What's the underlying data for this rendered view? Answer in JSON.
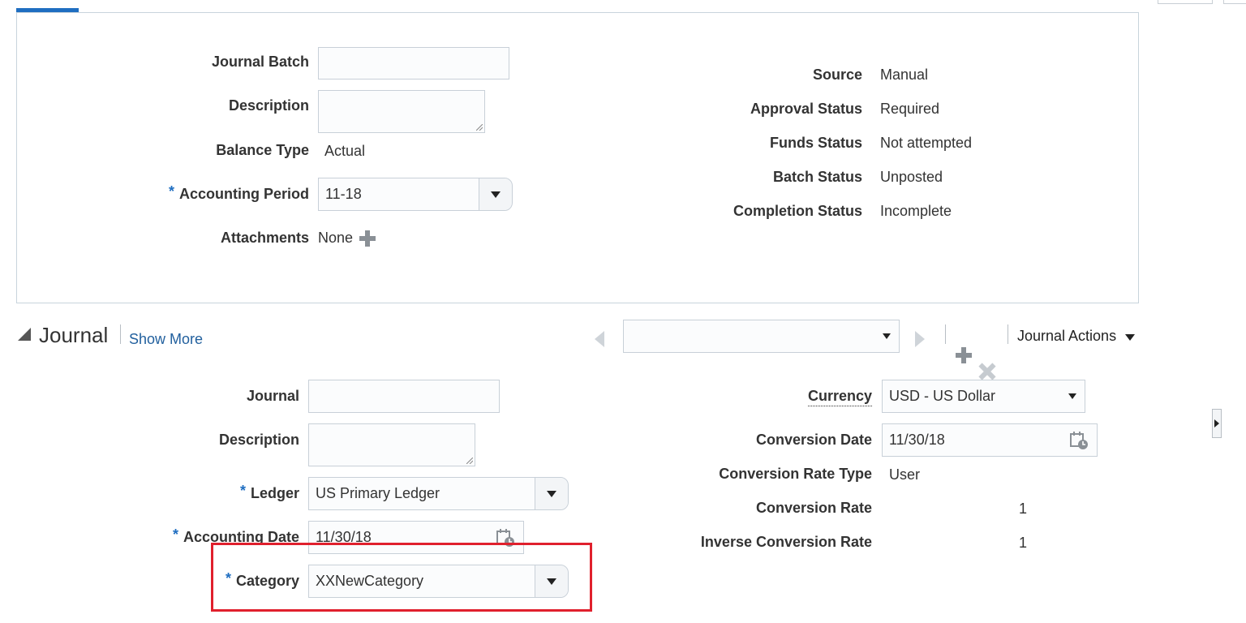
{
  "batch": {
    "journal_batch_label": "Journal Batch",
    "journal_batch_value": "",
    "description_label": "Description",
    "description_value": "",
    "balance_type_label": "Balance Type",
    "balance_type_value": "Actual",
    "accounting_period_label": "Accounting Period",
    "accounting_period_value": "11-18",
    "attachments_label": "Attachments",
    "attachments_value": "None",
    "source_label": "Source",
    "source_value": "Manual",
    "approval_status_label": "Approval Status",
    "approval_status_value": "Required",
    "funds_status_label": "Funds Status",
    "funds_status_value": "Not attempted",
    "batch_status_label": "Batch Status",
    "batch_status_value": "Unposted",
    "completion_status_label": "Completion Status",
    "completion_status_value": "Incomplete"
  },
  "journal": {
    "section_title": "Journal",
    "show_more_label": "Show More",
    "selector_value": "",
    "actions_label": "Journal Actions",
    "journal_label": "Journal",
    "journal_value": "",
    "description_label": "Description",
    "description_value": "",
    "ledger_label": "Ledger",
    "ledger_value": "US Primary Ledger",
    "accounting_date_label": "Accounting Date",
    "accounting_date_value": "11/30/18",
    "category_label": "Category",
    "category_value": "XXNewCategory",
    "currency_label": "Currency",
    "currency_value": "USD - US Dollar",
    "conversion_date_label": "Conversion Date",
    "conversion_date_value": "11/30/18",
    "conversion_rate_type_label": "Conversion Rate Type",
    "conversion_rate_type_value": "User",
    "conversion_rate_label": "Conversion Rate",
    "conversion_rate_value": "1",
    "inverse_conversion_rate_label": "Inverse Conversion Rate",
    "inverse_conversion_rate_value": "1"
  },
  "required_marker": "*",
  "colors": {
    "accent": "#1f6ec1",
    "link": "#22609e",
    "highlight": "#e0202d",
    "panel_border": "#c8d4dc"
  },
  "icons": [
    "add-icon",
    "remove-icon",
    "calendar-icon",
    "dropdown-icon",
    "collapse-triangle-icon",
    "previous-icon",
    "next-icon",
    "panel-expand-icon"
  ]
}
